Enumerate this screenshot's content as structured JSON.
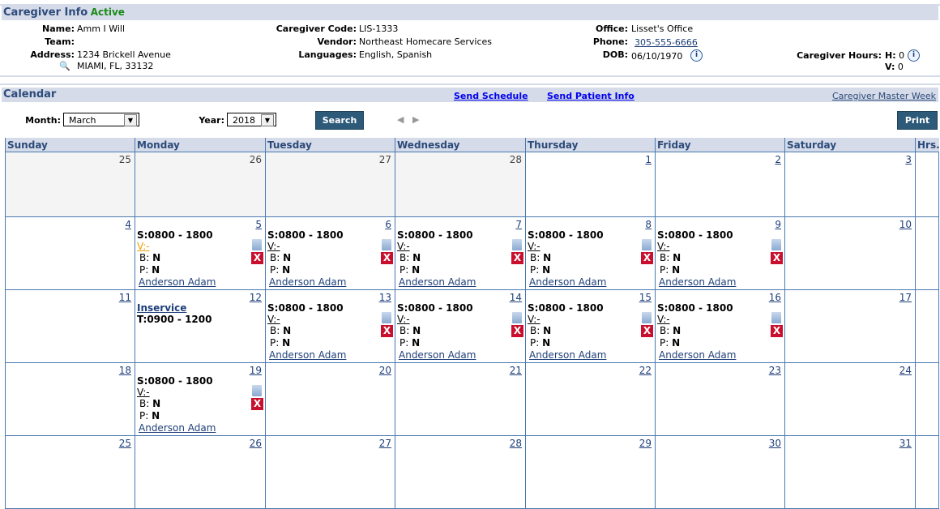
{
  "info": {
    "title": "Caregiver Info",
    "status": "Active",
    "name_label": "Name:",
    "name": "Amm I Will",
    "team_label": "Team:",
    "team": "",
    "address_label": "Address:",
    "address1": "1234 Brickell Avenue",
    "address2": "MIAMI, FL, 33132",
    "code_label": "Caregiver Code:",
    "code": "LIS-1333",
    "vendor_label": "Vendor:",
    "vendor": "Northeast Homecare Services",
    "languages_label": "Languages:",
    "languages": "English, Spanish",
    "office_label": "Office:",
    "office": "Lisset's Office",
    "phone_label": "Phone:",
    "phone": "305-555-6666",
    "dob_label": "DOB:",
    "dob": "06/10/1970",
    "hours_label": "Caregiver Hours:",
    "h_label": "H:",
    "h": "0",
    "v_label": "V:",
    "v": "0"
  },
  "calendar": {
    "title": "Calendar",
    "send_schedule": "Send Schedule",
    "send_patient": "Send Patient Info",
    "master_week": "Caregiver Master Week",
    "month_label": "Month:",
    "month": "March",
    "year_label": "Year:",
    "year": "2018",
    "search": "Search",
    "print": "Print",
    "headers": [
      "Sunday",
      "Monday",
      "Tuesday",
      "Wednesday",
      "Thursday",
      "Friday",
      "Saturday",
      "Hrs."
    ],
    "weeks": [
      [
        {
          "d": "25",
          "m": true
        },
        {
          "d": "26",
          "m": true
        },
        {
          "d": "27",
          "m": true
        },
        {
          "d": "28",
          "m": true
        },
        {
          "d": "1"
        },
        {
          "d": "2"
        },
        {
          "d": "3"
        }
      ],
      [
        {
          "d": "4"
        },
        {
          "d": "5",
          "s": "S:0800 - 1800",
          "v": "V:-",
          "warn": true,
          "b": "N",
          "p": "N",
          "cg": "Anderson Adam"
        },
        {
          "d": "6",
          "s": "S:0800 - 1800",
          "v": "V:-",
          "b": "N",
          "p": "N",
          "cg": "Anderson Adam"
        },
        {
          "d": "7",
          "s": "S:0800 - 1800",
          "v": "V:-",
          "b": "N",
          "p": "N",
          "cg": "Anderson Adam"
        },
        {
          "d": "8",
          "s": "S:0800 - 1800",
          "v": "V:-",
          "b": "N",
          "p": "N",
          "cg": "Anderson Adam"
        },
        {
          "d": "9",
          "s": "S:0800 - 1800",
          "v": "V:-",
          "b": "N",
          "p": "N",
          "cg": "Anderson Adam"
        },
        {
          "d": "10"
        }
      ],
      [
        {
          "d": "11"
        },
        {
          "d": "12",
          "inservice": "Inservice",
          "t": "T:0900 - 1200"
        },
        {
          "d": "13",
          "s": "S:0800 - 1800",
          "v": "V:-",
          "b": "N",
          "p": "N",
          "cg": "Anderson Adam"
        },
        {
          "d": "14",
          "s": "S:0800 - 1800",
          "v": "V:-",
          "b": "N",
          "p": "N",
          "cg": "Anderson Adam"
        },
        {
          "d": "15",
          "s": "S:0800 - 1800",
          "v": "V:-",
          "b": "N",
          "p": "N",
          "cg": "Anderson Adam"
        },
        {
          "d": "16",
          "s": "S:0800 - 1800",
          "v": "V:-",
          "b": "N",
          "p": "N",
          "cg": "Anderson Adam"
        },
        {
          "d": "17"
        }
      ],
      [
        {
          "d": "18"
        },
        {
          "d": "19",
          "s": "S:0800 - 1800",
          "v": "V:-",
          "b": "N",
          "p": "N",
          "cg": "Anderson Adam"
        },
        {
          "d": "20"
        },
        {
          "d": "21"
        },
        {
          "d": "22"
        },
        {
          "d": "23"
        },
        {
          "d": "24"
        }
      ],
      [
        {
          "d": "25"
        },
        {
          "d": "26"
        },
        {
          "d": "27"
        },
        {
          "d": "28"
        },
        {
          "d": "29"
        },
        {
          "d": "30"
        },
        {
          "d": "31"
        }
      ]
    ],
    "b_label": "B:",
    "p_label": "P:"
  }
}
